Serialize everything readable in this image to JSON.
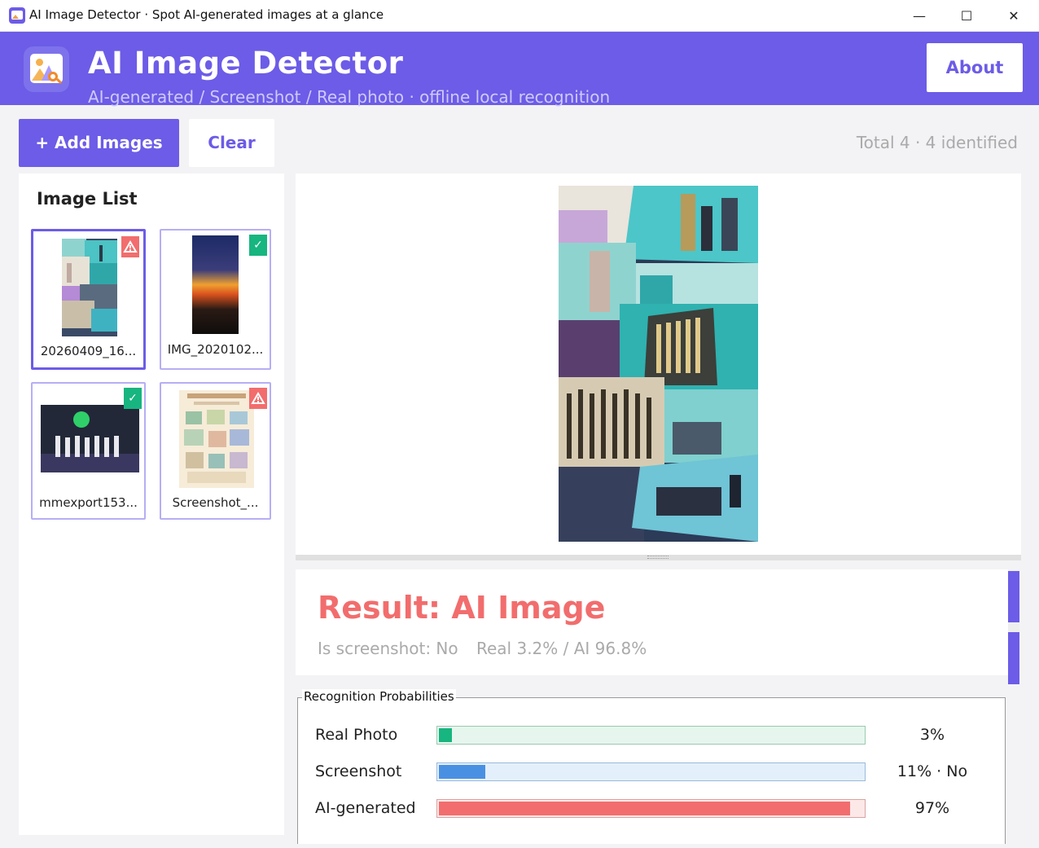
{
  "window": {
    "title": "AI Image Detector  ·  Spot AI-generated images at a glance",
    "minimize_glyph": "—",
    "maximize_glyph": "☐",
    "close_glyph": "✕"
  },
  "header": {
    "title": "AI Image Detector",
    "subtitle": "AI-generated / Screenshot / Real photo · offline local recognition",
    "about_label": "About",
    "accent_color": "#6c5ce7"
  },
  "toolbar": {
    "add_label": "+ Add Images",
    "clear_label": "Clear",
    "count_text": "Total 4 · 4 identified"
  },
  "image_list": {
    "title": "Image List",
    "items": [
      {
        "caption": "20260409_16...",
        "badge": "ai",
        "badge_icon": "ai-warning-icon",
        "selected": true
      },
      {
        "caption": "IMG_2020102...",
        "badge": "real",
        "badge_icon": "check-icon",
        "badge_glyph": "✓",
        "selected": false
      },
      {
        "caption": "mmexport153...",
        "badge": "real",
        "badge_icon": "check-icon",
        "badge_glyph": "✓",
        "selected": false
      },
      {
        "caption": "Screenshot_...",
        "badge": "ai",
        "badge_icon": "ai-warning-icon",
        "selected": false
      }
    ]
  },
  "result": {
    "title": "Result: AI Image",
    "is_screenshot": "Is screenshot: No",
    "ratio": "Real 3.2% / AI 96.8%",
    "color": "#f26d6d"
  },
  "probabilities": {
    "legend": "Recognition Probabilities",
    "rows": [
      {
        "label": "Real Photo",
        "value_text": "3%",
        "fraction": 0.03,
        "fill": "#17b57f",
        "track": "#e6f6ee",
        "track_border": "#9cc9b1"
      },
      {
        "label": "Screenshot",
        "value_text": "11% · No",
        "fraction": 0.11,
        "fill": "#4a90e2",
        "track": "#e3f0fb",
        "track_border": "#9bb9d9"
      },
      {
        "label": "AI-generated",
        "value_text": "97%",
        "fraction": 0.97,
        "fill": "#f26d6d",
        "track": "#fde8e8",
        "track_border": "#d9a3a3"
      }
    ]
  }
}
